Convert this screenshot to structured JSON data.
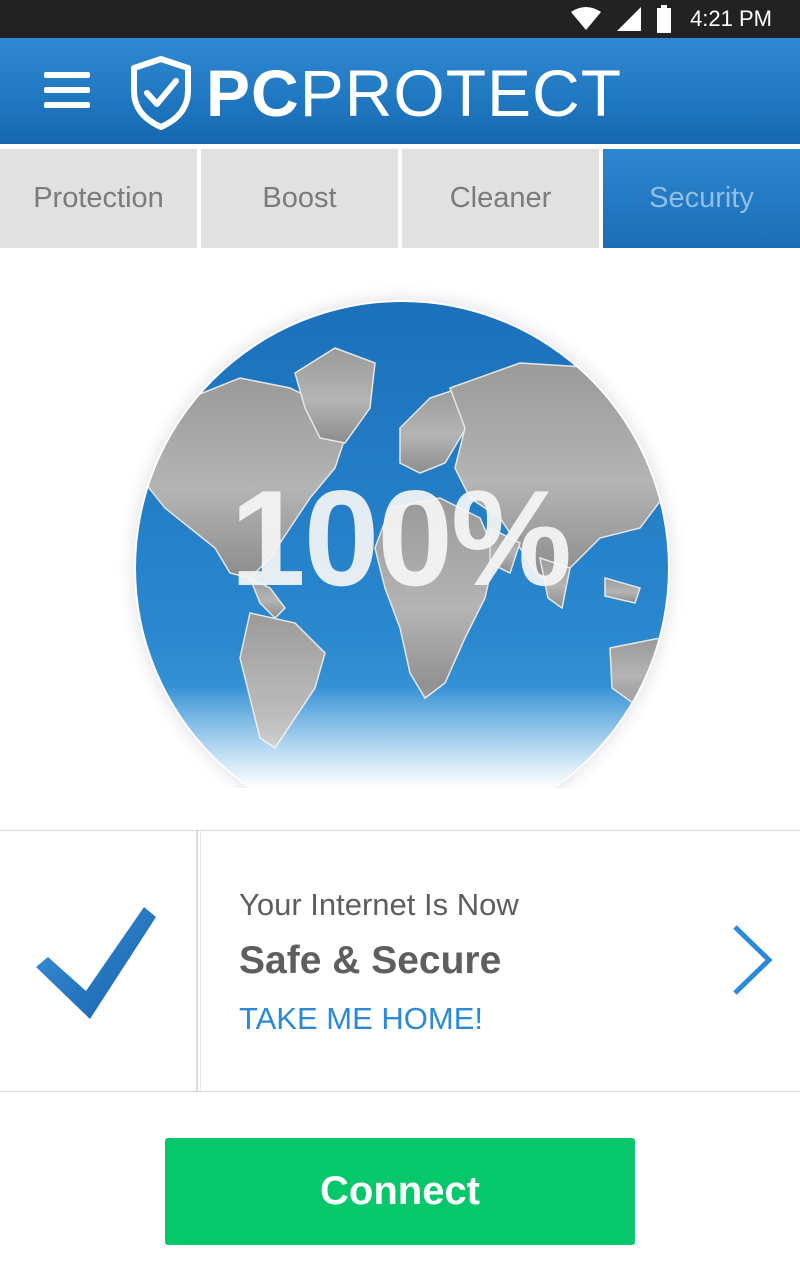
{
  "status_bar": {
    "time": "4:21 PM",
    "icons": [
      "wifi-icon",
      "signal-icon",
      "battery-icon"
    ]
  },
  "app_bar": {
    "logo_bold": "PC",
    "logo_regular": "PROTECT",
    "menu_icon": "hamburger-menu-icon",
    "logo_icon": "shield-check-icon"
  },
  "tabs": [
    {
      "label": "Protection",
      "active": false
    },
    {
      "label": "Boost",
      "active": false
    },
    {
      "label": "Cleaner",
      "active": false
    },
    {
      "label": "Security",
      "active": true
    }
  ],
  "globe": {
    "percentage": "100%",
    "icon": "world-globe-icon"
  },
  "status_card": {
    "line1": "Your Internet Is Now",
    "line2": "Safe & Secure",
    "link": "TAKE ME HOME!",
    "check_icon": "checkmark-icon",
    "chevron_icon": "chevron-right-icon"
  },
  "connect_button": {
    "label": "Connect"
  },
  "colors": {
    "app_bar_blue": "#1d74bd",
    "tab_inactive": "#e1e1e1",
    "link_blue": "#2a8ad8",
    "connect_green": "#06c86a"
  }
}
